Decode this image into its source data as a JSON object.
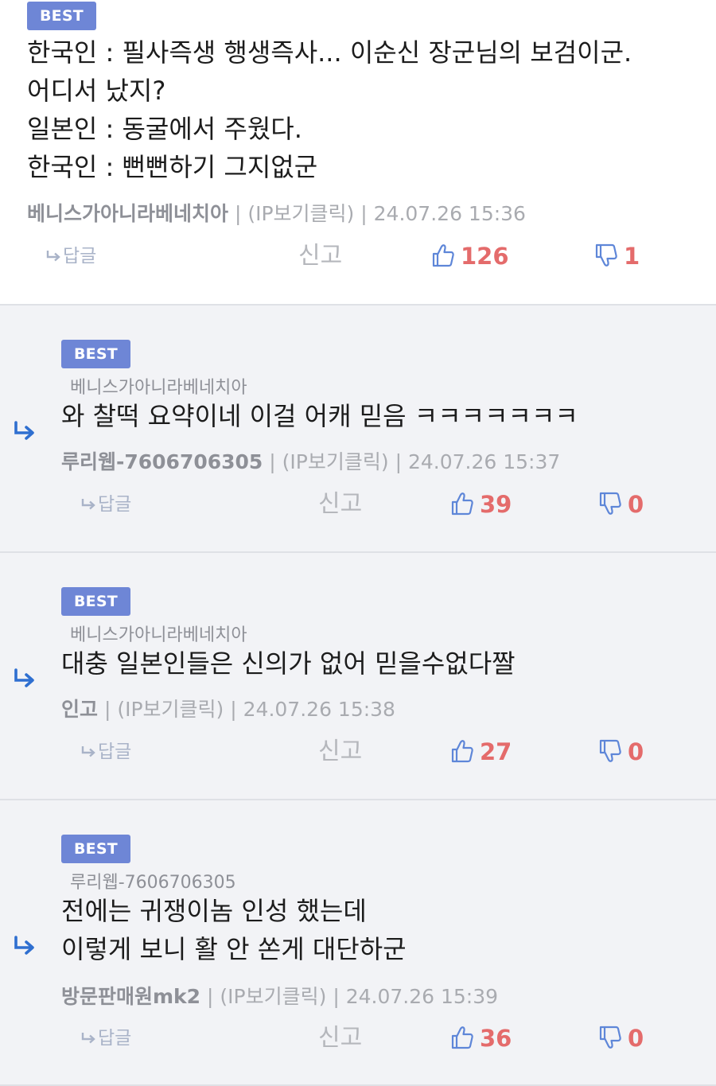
{
  "comments": [
    {
      "badge": "BEST",
      "lines": [
        "한국인 : 필사즉생 행생즉사... 이순신 장군님의 보검이군.",
        "어디서 났지?",
        "일본인 : 동굴에서 주웠다.",
        "한국인 : 뻔뻔하기 그지없군"
      ],
      "author": "베니스가아니라베네치아",
      "ip": "(IP보기클릭)",
      "time": "24.07.26 15:36",
      "reply_label": "답글",
      "report_label": "신고",
      "likes": "126",
      "dislikes": "1"
    },
    {
      "badge": "BEST",
      "parent": "베니스가아니라베네치아",
      "lines": [
        "와 찰떡 요약이네 이걸 어캐 믿음 ㅋㅋㅋㅋㅋㅋㅋ"
      ],
      "author": "루리웹-7606706305",
      "ip": "(IP보기클릭)",
      "time": "24.07.26 15:37",
      "reply_label": "답글",
      "report_label": "신고",
      "likes": "39",
      "dislikes": "0"
    },
    {
      "badge": "BEST",
      "parent": "베니스가아니라베네치아",
      "lines": [
        "대충 일본인들은 신의가 없어 믿을수없다짤"
      ],
      "author": "인고",
      "ip": "(IP보기클릭)",
      "time": "24.07.26 15:38",
      "reply_label": "답글",
      "report_label": "신고",
      "likes": "27",
      "dislikes": "0"
    },
    {
      "badge": "BEST",
      "parent": "루리웹-7606706305",
      "lines": [
        "전에는 귀쟁이놈 인성 했는데",
        "이렇게 보니 활 안 쏜게 대단하군"
      ],
      "author": "방문판매원mk2",
      "ip": "(IP보기클릭)",
      "time": "24.07.26 15:39",
      "reply_label": "답글",
      "report_label": "신고",
      "likes": "36",
      "dislikes": "0"
    }
  ],
  "colors": {
    "badge": "#6e86d6",
    "count": "#e46b6b",
    "reply_bg": "#f2f3f6",
    "reply_arrow": "#2f6fd0"
  },
  "icons": {
    "reply_arrow": "reply-arrow-icon",
    "small_reply": "reply-small-icon",
    "like": "thumbs-up-icon",
    "dislike": "thumbs-down-icon"
  }
}
